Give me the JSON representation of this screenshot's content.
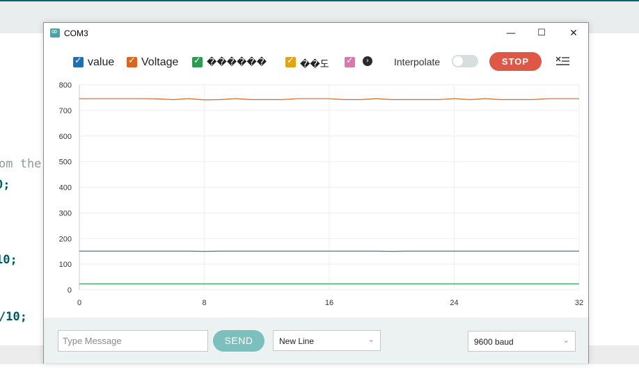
{
  "background_editor": {
    "line1": "om the",
    "line2": "0;",
    "line3": "10;",
    "line4": "/10;"
  },
  "window": {
    "title": "COM3",
    "controls": {
      "minimize": "—",
      "maximize": "☐",
      "close": "✕"
    }
  },
  "legend": {
    "items": [
      {
        "label": "value",
        "color": "#1f6fb2",
        "checked": true
      },
      {
        "label": "Voltage",
        "color": "#d9661f",
        "checked": true
      },
      {
        "label": "������",
        "color": "#2e9a52",
        "checked": true
      },
      {
        "label": "��도",
        "color": "#e0a31a",
        "checked": true
      },
      {
        "label": "",
        "color": "#d878ad",
        "checked": true
      }
    ],
    "interpolate_label": "Interpolate",
    "interpolate_on": false,
    "stop_label": "STOP"
  },
  "chart_data": {
    "type": "line",
    "x": [
      0,
      1,
      2,
      3,
      4,
      5,
      6,
      7,
      8,
      9,
      10,
      11,
      12,
      13,
      14,
      15,
      16,
      17,
      18,
      19,
      20,
      21,
      22,
      23,
      24,
      25,
      26,
      27,
      28,
      29,
      30,
      31,
      32
    ],
    "xticks": [
      "0",
      "8",
      "16",
      "24",
      "32"
    ],
    "yticks": [
      "0",
      "100",
      "200",
      "300",
      "400",
      "500",
      "600",
      "700",
      "800"
    ],
    "xlim": [
      0,
      32
    ],
    "ylim": [
      0,
      800
    ],
    "grid": true,
    "series": [
      {
        "color": "#d9661f",
        "values": [
          746,
          746,
          746,
          746,
          746,
          745,
          742,
          746,
          741,
          742,
          746,
          742,
          742,
          742,
          746,
          746,
          746,
          742,
          742,
          746,
          742,
          742,
          742,
          742,
          746,
          742,
          746,
          742,
          742,
          742,
          746,
          746,
          746
        ]
      },
      {
        "color": "#1f6fb2",
        "values": [
          151,
          151,
          151,
          151,
          151,
          151,
          151,
          151,
          150,
          151,
          151,
          151,
          151,
          151,
          151,
          151,
          151,
          151,
          151,
          151,
          150,
          151,
          151,
          151,
          151,
          151,
          151,
          151,
          151,
          151,
          151,
          151,
          151
        ]
      },
      {
        "color": "#2e9a52",
        "values": [
          23,
          23,
          23,
          23,
          23,
          23,
          23,
          23,
          23,
          23,
          23,
          23,
          23,
          23,
          23,
          23,
          23,
          23,
          23,
          23,
          23,
          23,
          23,
          23,
          23,
          23,
          23,
          23,
          23,
          23,
          23,
          23,
          23
        ]
      }
    ]
  },
  "bottom": {
    "message_placeholder": "Type Message",
    "send_label": "SEND",
    "line_ending": "New Line",
    "baud": "9600 baud"
  }
}
